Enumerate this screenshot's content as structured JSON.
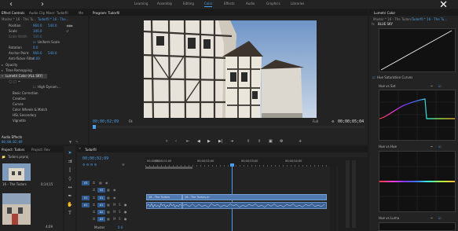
{
  "app": {
    "workspace_tabs": [
      "Learning",
      "Assembly",
      "Editing",
      "Color",
      "Effects",
      "Audio",
      "Graphics",
      "Libraries"
    ],
    "active_workspace": "Color"
  },
  "effect_controls": {
    "tabs": [
      "Effect Controls",
      "Audio Clip Mixer: Tudorfil",
      "Me"
    ],
    "master_label": "Master * 16 - The Tu...",
    "clip_label": "Tudorfil * 16 - The...",
    "rows": [
      {
        "label": "Position",
        "value": "960.0",
        "value2": "540.0"
      },
      {
        "label": "Scale",
        "value": "100.0"
      },
      {
        "label": "Scale Width",
        "value": "100.0"
      },
      {
        "label": "Uniform Scale"
      },
      {
        "label": "Rotation",
        "value": "0.0"
      },
      {
        "label": "Anchor Point",
        "value": "960.0",
        "value2": "540.0"
      },
      {
        "label": "Anti-flicker Filter",
        "value": "0.00"
      },
      {
        "label": "Opacity"
      },
      {
        "label": "Time Remapping"
      },
      {
        "label": "Lumetri Color (ALL SKY)"
      },
      {
        "label": "High Dynam..."
      },
      {
        "label": "Basic Correction"
      },
      {
        "label": "Creative"
      },
      {
        "label": "Curves"
      },
      {
        "label": "Color Wheels & Match"
      },
      {
        "label": "HSL Secondary"
      },
      {
        "label": "Vignette"
      }
    ],
    "audio_effects": "Audio Effects",
    "timecode": "00;00;02;09"
  },
  "program_monitor": {
    "title": "Program: Tudorfil",
    "timecode_current": "00;00;02;09",
    "fit": "Fit",
    "resolution": "Full",
    "timecode_duration": "00;00;05;04"
  },
  "lumetri": {
    "title": "Lumetri Color",
    "master_label": "Master * 16 - The Tudors",
    "clip_label": "Tudorfil * 16 - The Tu...",
    "preset": "BLUE SKY",
    "section_label": "Hue Saturation Curves",
    "hue_vs_sat": "Hue vs Sat",
    "hue_vs_hue": "Hue vs Hue",
    "hue_vs_luma": "Hue vs Luma"
  },
  "project": {
    "tabs": [
      "Project: Tudors",
      "Project: Rev"
    ],
    "folder": "Tudors.prproj",
    "items": [
      {
        "name": "16 - The Tudors",
        "duration": "0;14;15"
      },
      {
        "name": "",
        "duration": "4;09"
      }
    ]
  },
  "timeline": {
    "sequence": "Tudorfil",
    "timecode": "00;00;02;09",
    "ruler": [
      "00;00;00",
      "00;00;01;00",
      "00;00;02;00",
      "00;00;03;00",
      "00;00;04;00"
    ],
    "tracks": [
      "V3",
      "V2",
      "V1",
      "A1",
      "A2",
      "A3"
    ],
    "master": "Master",
    "master_value": "0.0",
    "clips": {
      "v1_a": "16 - The Tudors",
      "v1_b": "16 - The Tudors.m"
    }
  }
}
